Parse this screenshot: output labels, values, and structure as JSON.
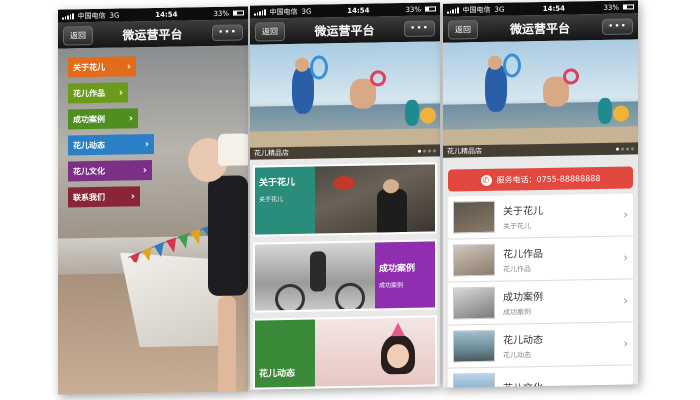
{
  "status": {
    "carrier": "中国电信",
    "network": "3G",
    "time": "14:54",
    "battery": "33%"
  },
  "nav": {
    "back": "返回",
    "title": "微运营平台",
    "more": "•••"
  },
  "phone1": {
    "menu": [
      {
        "label": "关于花儿",
        "color": "#e36c1c"
      },
      {
        "label": "花儿作品",
        "color": "#6a9b1c"
      },
      {
        "label": "成功案例",
        "color": "#4f8f22"
      },
      {
        "label": "花儿动态",
        "color": "#2a7fc7"
      },
      {
        "label": "花儿文化",
        "color": "#7b2f86"
      },
      {
        "label": "联系我们",
        "color": "#8a2538"
      }
    ],
    "chevron": "›"
  },
  "phone2": {
    "caption": "花儿精品店",
    "tiles": [
      {
        "title": "关于花儿",
        "sub": "关于花儿",
        "color": "#2a8c7a"
      },
      {
        "title": "成功案例",
        "sub": "成功案例",
        "color": "#8f2fb0"
      },
      {
        "title": "花儿动态",
        "sub": "",
        "color": "#3a8a3a"
      }
    ]
  },
  "phone3": {
    "caption": "花儿精品店",
    "call_label": "服务电话：0755-88888888",
    "items": [
      {
        "title": "关于花儿",
        "sub": "关于花儿"
      },
      {
        "title": "花儿作品",
        "sub": "花儿作品"
      },
      {
        "title": "成功案例",
        "sub": "成功案例"
      },
      {
        "title": "花儿动态",
        "sub": "花儿动态"
      },
      {
        "title": "花儿文化",
        "sub": ""
      }
    ],
    "chevron": "›"
  }
}
